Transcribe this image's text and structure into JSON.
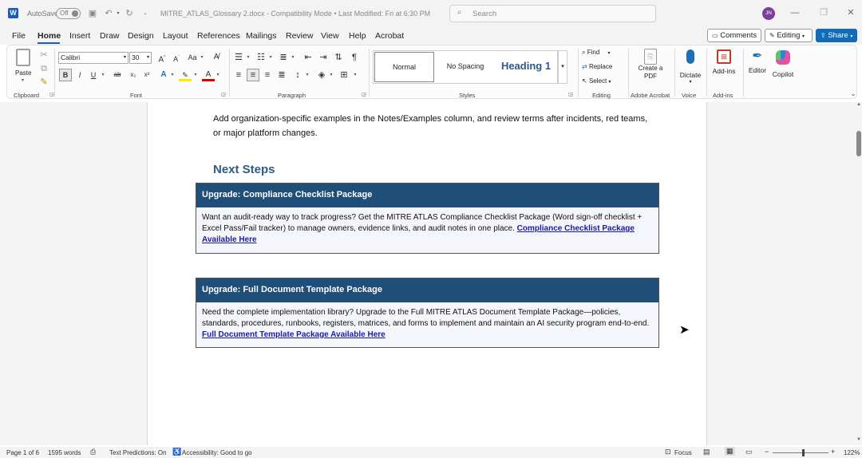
{
  "titlebar": {
    "autosave_label": "AutoSave",
    "autosave_state": "Off",
    "doc_title": "MITRE_ATLAS_Glossary 2.docx  -  Compatibility Mode  •  Last Modified: Fri at 6:30 PM",
    "search_placeholder": "Search",
    "user_initials": "JN"
  },
  "menu": {
    "tabs": [
      "File",
      "Home",
      "Insert",
      "Draw",
      "Design",
      "Layout",
      "References",
      "Mailings",
      "Review",
      "View",
      "Help",
      "Acrobat"
    ],
    "active_tab": "Home",
    "comments_label": "Comments",
    "editing_label": "Editing",
    "share_label": "Share"
  },
  "ribbon": {
    "clipboard": {
      "paste": "Paste",
      "group": "Clipboard"
    },
    "font": {
      "name": "Calibri",
      "size": "30",
      "group": "Font"
    },
    "paragraph": {
      "group": "Paragraph"
    },
    "styles": {
      "normal": "Normal",
      "no_spacing": "No Spacing",
      "heading1": "Heading 1",
      "group": "Styles"
    },
    "editing": {
      "find": "Find",
      "replace": "Replace",
      "select": "Select",
      "group": "Editing"
    },
    "acrobat": {
      "create_pdf": "Create a PDF",
      "group": "Adobe Acrobat"
    },
    "voice": {
      "dictate": "Dictate",
      "group": "Voice"
    },
    "addins": {
      "addins": "Add-ins",
      "editor": "Editor",
      "copilot": "Copilot",
      "group": "Add-ins"
    }
  },
  "document": {
    "intro": "Add organization-specific examples in the Notes/Examples column, and review terms after incidents, red teams, or major platform changes.",
    "heading": "Next Steps",
    "box1": {
      "title": "Upgrade: Compliance Checklist Package",
      "body": "Want an audit-ready way to track progress? Get the MITRE ATLAS Compliance Checklist Package (Word sign-off checklist + Excel Pass/Fail tracker) to manage owners, evidence links, and audit notes in one place.",
      "link": "Compliance Checklist Package Available Here"
    },
    "box2": {
      "title": "Upgrade: Full Document Template Package",
      "body": "Need the complete implementation library? Upgrade to the Full MITRE ATLAS Document Template Package—policies, standards, procedures, runbooks, registers, matrices, and forms to implement and maintain an AI security program end-to-end.",
      "link": "Full Document Template Package Available Here"
    }
  },
  "status": {
    "page": "Page 1 of 6",
    "words": "1595 words",
    "predictions": "Text Predictions: On",
    "accessibility": "Accessibility: Good to go",
    "focus": "Focus",
    "zoom": "122%"
  },
  "colors": {
    "accent": "#1f4e79",
    "share": "#0f6cbd",
    "link": "#1a1aa6",
    "heading": "#2e5a87"
  }
}
